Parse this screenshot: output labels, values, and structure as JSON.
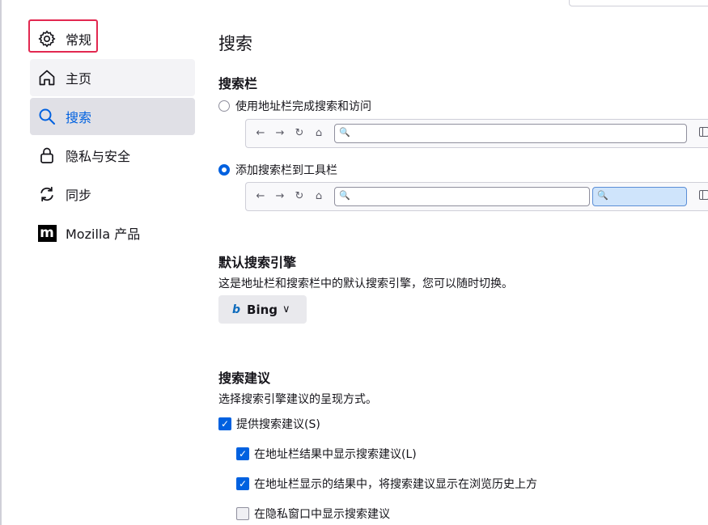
{
  "sidebar": {
    "items": [
      {
        "label": "常规",
        "icon": "gear-icon"
      },
      {
        "label": "主页",
        "icon": "home-icon"
      },
      {
        "label": "搜索",
        "icon": "search-icon"
      },
      {
        "label": "隐私与安全",
        "icon": "lock-icon"
      },
      {
        "label": "同步",
        "icon": "sync-icon"
      },
      {
        "label": "Mozilla 产品",
        "icon": "mozilla-logo-icon",
        "icon_text": "m"
      }
    ],
    "selected": "搜索",
    "highlight_color": "#e22850"
  },
  "main": {
    "title": "搜索",
    "search_bar": {
      "heading": "搜索栏",
      "option_urlbar": "使用地址栏完成搜索和访问",
      "option_toolbar": "添加搜索栏到工具栏",
      "selected": "添加搜索栏到工具栏"
    },
    "preview_icons": {
      "back": "←",
      "forward": "→",
      "reload": "↻",
      "home": "⌂",
      "magnifier": "🔍"
    },
    "default_engine": {
      "heading": "默认搜索引擎",
      "description": "这是地址栏和搜索栏中的默认搜索引擎，您可以随时切换。",
      "engine": "Bing",
      "engine_icon": "b",
      "chevron": "∨"
    },
    "suggestions": {
      "heading": "搜索建议",
      "description": "选择搜索引擎建议的呈现方式。",
      "provide": {
        "label": "提供搜索建议(S)",
        "checked": true
      },
      "in_results": {
        "label": "在地址栏结果中显示搜索建议(L)",
        "checked": true
      },
      "ahead_of_history": {
        "label": "在地址栏显示的结果中，将搜索建议显示在浏览历史上方",
        "checked": true
      },
      "private": {
        "label": "在隐私窗口中显示搜索建议",
        "checked": false
      }
    },
    "check_mark": "✓"
  },
  "colors": {
    "accent": "#0061e0",
    "selected_bg": "#e0e0e6",
    "search_highlight": "#cfe4fb"
  }
}
